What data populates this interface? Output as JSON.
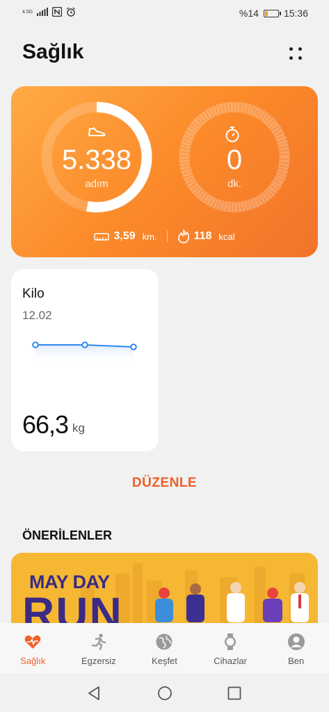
{
  "status": {
    "network": "4.5G",
    "battery": "%14",
    "time": "15:36"
  },
  "header": {
    "title": "Sağlık",
    "more_icon": "more-dots-icon"
  },
  "activity": {
    "steps_value": "5.338",
    "steps_unit": "adım",
    "steps_progress": 0.53,
    "duration_value": "0",
    "duration_unit": "dk.",
    "distance_value": "3,59",
    "distance_unit": "km.",
    "calories_value": "118",
    "calories_unit": "kcal",
    "colors": {
      "card_start": "#ffab45",
      "card_end": "#f2732b"
    }
  },
  "weight": {
    "title": "Kilo",
    "date": "12.02",
    "value": "66,3",
    "unit": "kg",
    "trend_icon": "weight-trend-line"
  },
  "edit_label": "DÜZENLE",
  "recommended": {
    "title": "ÖNERİLENLER",
    "banner_text_1": "MAY DAY",
    "banner_text_2": "RUN"
  },
  "nav": {
    "items": [
      {
        "label": "Sağlık",
        "icon": "heart-pulse-icon",
        "active": true
      },
      {
        "label": "Egzersiz",
        "icon": "running-icon",
        "active": false
      },
      {
        "label": "Keşfet",
        "icon": "globe-icon",
        "active": false
      },
      {
        "label": "Cihazlar",
        "icon": "watch-icon",
        "active": false
      },
      {
        "label": "Ben",
        "icon": "person-icon",
        "active": false
      }
    ]
  },
  "accent_color": "#f1622a"
}
